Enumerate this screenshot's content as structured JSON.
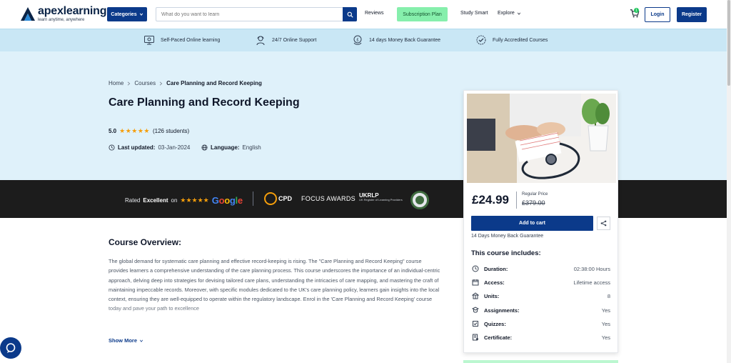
{
  "header": {
    "logo_name": "apexlearning",
    "logo_tagline": "learn anytime, anywhere",
    "categories_label": "Categories",
    "search_placeholder": "What do you want to learn",
    "reviews": "Reviews",
    "subscription": "Subscription Plan",
    "study_smart": "Study Smart",
    "explore": "Explore",
    "cart_count": "1",
    "login": "Login",
    "register": "Register"
  },
  "features": [
    {
      "label": "Self-Paced Online learning",
      "icon": "monitor-icon"
    },
    {
      "label": "24/7 Online Support",
      "icon": "support-agent-icon"
    },
    {
      "label": "14 days Money Back Guarantee",
      "icon": "money-back-icon"
    },
    {
      "label": "Fully Accredited Courses",
      "icon": "accredited-badge-icon"
    }
  ],
  "breadcrumb": [
    "Home",
    "Courses",
    "Care Planning and Record Keeping"
  ],
  "course": {
    "title": "Care Planning and Record Keeping",
    "rating": "5.0",
    "stars": 5,
    "students": "(126 students)",
    "last_updated_label": "Last updated:",
    "last_updated": "03-Jan-2024",
    "language_label": "Language:",
    "language": "English"
  },
  "trust": {
    "rated": "Rated",
    "excellent": "Excellent",
    "on": "on",
    "google": "Google",
    "cpd": "CPD",
    "focus": "FOCUS AWARDS",
    "ukrlp": "UKRLP",
    "ukrlp_sub": "UK Register of Learning Providers"
  },
  "overview": {
    "title": "Course Overview:",
    "text": "The global demand for systematic care planning and effective record-keeping is rising. The \"Care Planning and Record Keeping\" course provides learners a comprehensive understanding of the care planning process. This course underscores the importance of an individual-centric approach, delving deep into strategies for devising tailored care plans, understanding the intricacies of care mapping, and mastering the craft of maintaining impeccable records.  Moreover, with specific modules dedicated to the UK's care planning policy, learners gain insights into the local context, ensuring they are well-equipped to operate within the regulatory landscape. Enrol in the 'Care Planning and Record Keeping' course today and pave your path to excellence",
    "show_more": "Show More"
  },
  "card": {
    "price": "£24.99",
    "regular_label": "Regular Price",
    "old_price": "£379.00",
    "add_to_cart": "Add to cart",
    "guarantee": "14 Days Money Back Guarantee",
    "includes_title": "This course includes:",
    "includes": [
      {
        "label": "Duration:",
        "value": "02:38:00 Hours",
        "icon": "clock-icon"
      },
      {
        "label": "Access:",
        "value": "Lifetime access",
        "icon": "calendar-icon"
      },
      {
        "label": "Units:",
        "value": "8",
        "icon": "units-icon"
      },
      {
        "label": "Assignments:",
        "value": "Yes",
        "icon": "assignment-icon"
      },
      {
        "label": "Quizzes:",
        "value": "Yes",
        "icon": "quiz-icon"
      },
      {
        "label": "Certificate:",
        "value": "Yes",
        "icon": "certificate-icon"
      }
    ]
  },
  "colors": {
    "brand_blue": "#0b3a8a",
    "subscription_green": "#86efac",
    "hero_bg": "#dff1fa",
    "features_bg": "#c9e7f5",
    "trust_bg": "#1c1c1c",
    "star": "#f59e0b"
  }
}
